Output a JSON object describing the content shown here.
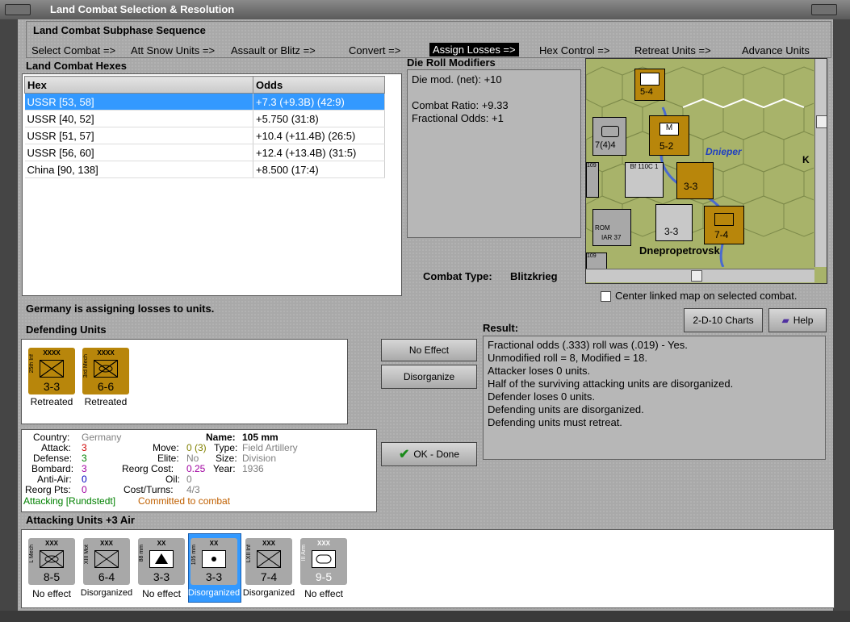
{
  "window": {
    "title": "Land Combat Selection & Resolution"
  },
  "sequence": {
    "heading": "Land Combat Subphase Sequence",
    "steps": [
      "Select Combat =>",
      "Att Snow Units =>",
      "Assault or Blitz =>",
      "Convert =>",
      "Assign Losses =>",
      "Hex Control =>",
      "Retreat Units =>",
      "Advance Units"
    ],
    "active": "Assign Losses =>"
  },
  "hexes": {
    "heading": "Land Combat Hexes",
    "columns": [
      "Hex",
      "Odds"
    ],
    "rows": [
      [
        "USSR [53, 58]",
        "+7.3 (+9.3B) (42:9)"
      ],
      [
        "USSR [40, 52]",
        "+5.750 (31:8)"
      ],
      [
        "USSR [51, 57]",
        "+10.4 (+11.4B) (26:5)"
      ],
      [
        "USSR [56, 60]",
        "+12.4 (+13.4B) (31:5)"
      ],
      [
        "China [90, 138]",
        "+8.500 (17:4)"
      ]
    ]
  },
  "modifiers": {
    "heading": "Die Roll Modifiers",
    "lines": [
      "Die mod. (net): +10",
      "",
      "Combat Ratio: +9.33",
      "Fractional Odds: +1"
    ]
  },
  "combat_type": {
    "label": "Combat Type:",
    "value": "Blitzkrieg"
  },
  "map": {
    "labels": [
      "Dnieper",
      "Dnepropetrovsk",
      "K"
    ],
    "counters": [
      "5-4",
      "7(4)4",
      "5-2",
      "3-3",
      "3-3",
      "7-4",
      "Bf 110C 1",
      "IAR 37",
      "ROM",
      "109",
      "109"
    ]
  },
  "center_map": {
    "label": "Center linked map on selected combat.",
    "checked": false
  },
  "status": "Germany is assigning losses to units.",
  "defending": {
    "heading": "Defending Units",
    "units": [
      {
        "name": "25th Inf",
        "size": "XXXX",
        "value": "3-3",
        "status": "Retreated"
      },
      {
        "name": "3rd Mech",
        "size": "XXXX",
        "value": "6-6",
        "status": "Retreated"
      }
    ]
  },
  "buttons": {
    "no_effect": "No Effect",
    "disorganize": "Disorganize",
    "ok_done": "OK - Done",
    "charts": "2-D-10 Charts",
    "help": "Help"
  },
  "result": {
    "heading": "Result:",
    "lines": [
      "Fractional odds (.333) roll was (.019)  - Yes.",
      "Unmodified roll = 8, Modified = 18.",
      "Attacker loses 0 units.",
      "Half of the surviving attacking units are disorganized.",
      "Defender loses 0 units.",
      "Defending units are disorganized.",
      "Defending units must retreat."
    ]
  },
  "unit_info": {
    "country_label": "Country:",
    "country": "Germany",
    "attack_label": "Attack:",
    "attack": "3",
    "defense_label": "Defense:",
    "defense": "3",
    "bombard_label": "Bombard:",
    "bombard": "3",
    "antiair_label": "Anti-Air:",
    "antiair": "0",
    "reorg_label": "Reorg Pts:",
    "reorg": "0",
    "name_label": "Name:",
    "name": "105 mm",
    "move_label": "Move:",
    "move": "0 (3)",
    "type_label": "Type:",
    "type": "Field Artillery",
    "elite_label": "Elite:",
    "elite": "No",
    "size_label": "Size:",
    "size": "Division",
    "reorgcost_label": "Reorg Cost:",
    "reorgcost": "0.25",
    "year_label": "Year:",
    "year": "1936",
    "oil_label": "Oil:",
    "oil": "0",
    "cost_label": "Cost/Turns:",
    "cost": "4/3",
    "attacking": "Attacking [Rundstedt]",
    "committed": "Committed to combat"
  },
  "attacking": {
    "heading": "Attacking Units +3 Air",
    "units": [
      {
        "name": "L Mech",
        "size": "XXX",
        "value": "8-5",
        "status": "No effect"
      },
      {
        "name": "XIII Mot",
        "size": "XXX",
        "value": "6-4",
        "status": "Disorganized"
      },
      {
        "name": "88 mm",
        "size": "XX",
        "value": "3-3",
        "status": "No effect"
      },
      {
        "name": "105 mm",
        "size": "XX",
        "value": "3-3",
        "status": "Disorganized"
      },
      {
        "name": "LXII Inf",
        "size": "XXX",
        "value": "7-4",
        "status": "Disorganized"
      },
      {
        "name": "III Arm",
        "size": "XXX",
        "value": "9-5",
        "status": "No effect"
      }
    ],
    "selected_index": 3
  },
  "colors": {
    "selection": "#3399ff",
    "german_counter": "#b8860b",
    "map_green": "#a8b36a"
  }
}
